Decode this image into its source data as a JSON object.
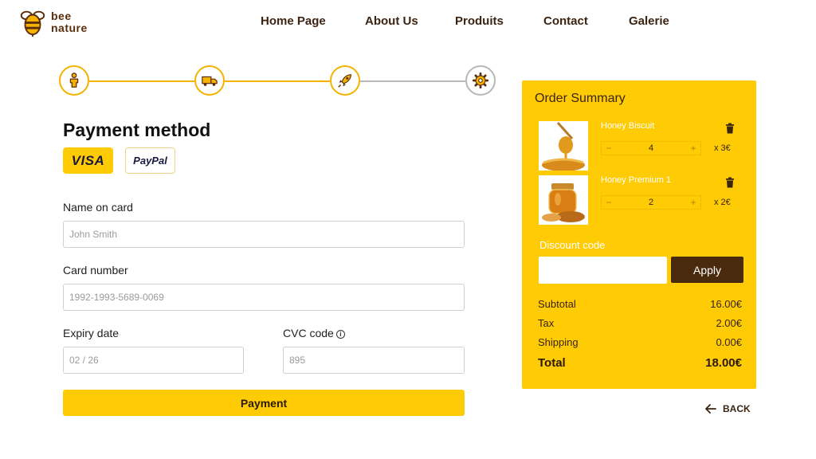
{
  "brand": {
    "line1": "bee",
    "line2": "nature"
  },
  "nav": [
    {
      "label": "Home Page"
    },
    {
      "label": "About Us"
    },
    {
      "label": "Produits"
    },
    {
      "label": "Contact"
    },
    {
      "label": "Galerie"
    }
  ],
  "stepper": {
    "steps": [
      {
        "icon": "person-icon",
        "state": "completed"
      },
      {
        "icon": "truck-icon",
        "state": "completed"
      },
      {
        "icon": "rocket-icon",
        "state": "completed"
      },
      {
        "icon": "gear-icon",
        "state": "pending"
      }
    ],
    "active_color": "#f5b300",
    "inactive_color": "#b8b8b8"
  },
  "payment": {
    "title": "Payment method",
    "methods": [
      {
        "label": "VISA",
        "selected": true
      },
      {
        "label": "PayPal",
        "selected": false
      }
    ],
    "name_label": "Name on card",
    "name_placeholder": "John Smith",
    "card_label": "Card number",
    "card_placeholder": "1992-1993-5689-0069",
    "expiry_label": "Expiry date",
    "expiry_placeholder": "02 / 26",
    "cvc_label": "CVC code",
    "cvc_placeholder": "895",
    "submit_label": "Payment"
  },
  "summary": {
    "title": "Order Summary",
    "items": [
      {
        "name": "Honey Biscuit",
        "qty": "4",
        "price": "x 3€"
      },
      {
        "name": "Honey Premium 1",
        "qty": "2",
        "price": "x 2€"
      }
    ],
    "discount_label": "Discount code",
    "discount_value": "",
    "apply_label": "Apply",
    "subtotal_label": "Subtotal",
    "subtotal": "16.00€",
    "tax_label": "Tax",
    "tax": "2.00€",
    "shipping_label": "Shipping",
    "shipping": "0.00€",
    "total_label": "Total",
    "total": "18.00€"
  },
  "back_label": "BACK",
  "colors": {
    "accent": "#ffcb05",
    "brown": "#4a2a0d"
  }
}
